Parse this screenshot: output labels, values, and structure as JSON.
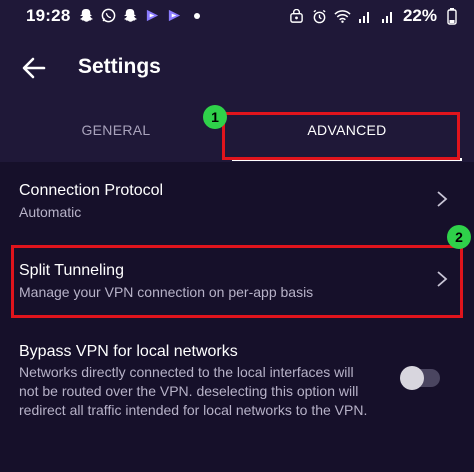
{
  "status_bar": {
    "time": "19:28",
    "left_icons": [
      "snapchat-icon",
      "whatsapp-icon",
      "snapchat-icon",
      "proton-vpn-icon",
      "proton-vpn-icon",
      "dot-icon"
    ],
    "right_icons": [
      "vpn-key-icon",
      "alarm-icon",
      "wifi-icon",
      "signal-icon",
      "signal-icon"
    ],
    "battery": "22%"
  },
  "header": {
    "title": "Settings",
    "back_icon": "arrow-left-icon"
  },
  "tabs": [
    {
      "label": "GENERAL",
      "selected": false
    },
    {
      "label": "ADVANCED",
      "selected": true
    }
  ],
  "annotations": {
    "badge_1": "1",
    "badge_2": "2",
    "highlight_color": "#e0141c",
    "badge_color": "#2fd14a"
  },
  "settings": {
    "connection_protocol": {
      "title": "Connection Protocol",
      "value": "Automatic"
    },
    "split_tunneling": {
      "title": "Split Tunneling",
      "description": "Manage your VPN connection on per-app basis"
    },
    "bypass_vpn": {
      "title": "Bypass VPN for local networks",
      "description_lines": [
        "Networks directly connected to the local interfaces will",
        "not be routed over the VPN. deselecting this option will",
        "redirect all traffic intended for local networks to the VPN."
      ],
      "enabled": false
    }
  },
  "colors": {
    "background": "#16102a",
    "header": "#1f1838",
    "text_secondary": "#b7b2c8"
  }
}
